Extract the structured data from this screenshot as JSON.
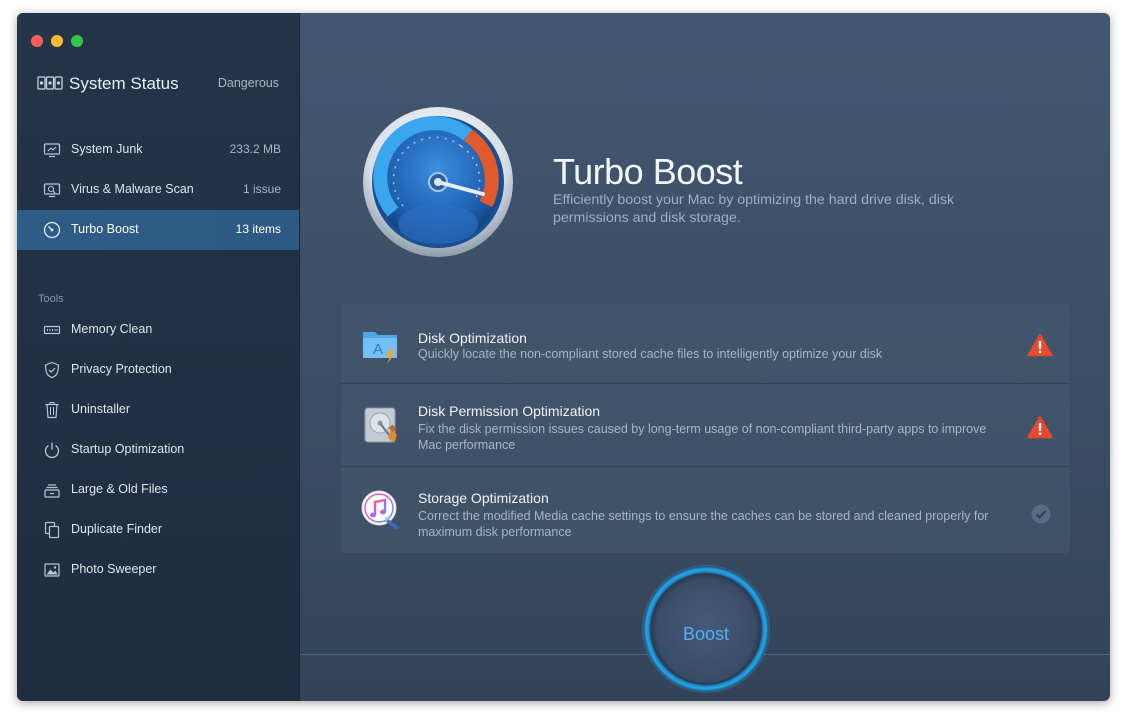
{
  "sidebar": {
    "status_title": "System Status",
    "status_state": "Dangerous",
    "scan_items": [
      {
        "label": "System Junk",
        "value": "233.2 MB",
        "icon": "monitor-icon"
      },
      {
        "label": "Virus & Malware Scan",
        "value": "1 issue",
        "icon": "magnifier-icon"
      },
      {
        "label": "Turbo Boost",
        "value": "13 items",
        "icon": "speedometer-icon"
      }
    ],
    "tools_label": "Tools",
    "tools": [
      {
        "label": "Memory Clean",
        "icon": "memory-chip-icon"
      },
      {
        "label": "Privacy Protection",
        "icon": "shield-icon"
      },
      {
        "label": "Uninstaller",
        "icon": "trash-icon"
      },
      {
        "label": "Startup Optimization",
        "icon": "power-icon"
      },
      {
        "label": "Large & Old Files",
        "icon": "file-stack-icon"
      },
      {
        "label": "Duplicate Finder",
        "icon": "duplicate-icon"
      },
      {
        "label": "Photo Sweeper",
        "icon": "photo-icon"
      }
    ]
  },
  "hero": {
    "title": "Turbo Boost",
    "description": "Efficiently boost your Mac by optimizing the hard drive disk, disk permissions and disk storage."
  },
  "optimizations": [
    {
      "title": "Disk Optimization",
      "description": "Quickly locate the non-compliant stored cache files to intelligently optimize your disk",
      "status": "warning"
    },
    {
      "title": "Disk Permission Optimization",
      "description": "Fix the disk permission issues caused by long-term usage of non-compliant third-party apps to improve Mac performance",
      "status": "warning"
    },
    {
      "title": "Storage Optimization",
      "description": "Correct the modified Media cache settings to ensure the caches can be stored and cleaned properly for maximum disk performance",
      "status": "ok"
    }
  ],
  "boost_button": {
    "label": "Boost"
  },
  "colors": {
    "accent": "#4fb3f2",
    "active_row": "#2f5c86",
    "warning": "#e8492d"
  }
}
